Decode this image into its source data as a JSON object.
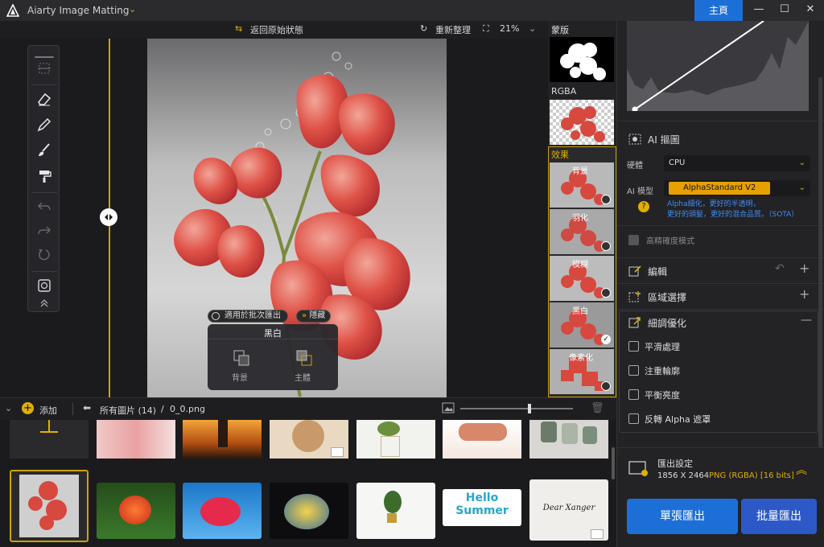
{
  "titlebar": {
    "app_title": "Aiarty Image Matting",
    "home_label": "主頁",
    "minimize": "—",
    "maximize": "☐",
    "close": "✕"
  },
  "canvas_toolbar": {
    "revert_label": "返回原始狀態",
    "reset_label": "重新整理",
    "zoom_value": "21%"
  },
  "floating": {
    "batch_label": "適用於批次匯出",
    "hide_label": "隱藏",
    "panel_title": "黑白",
    "bg_label": "背景",
    "subject_label": "主體"
  },
  "side_strip": {
    "mask_label": "蒙版",
    "rgba_label": "RGBA",
    "effects_label": "效果",
    "effects": [
      "背景",
      "羽化",
      "模糊",
      "黑白",
      "像素化"
    ]
  },
  "right_panel": {
    "ai_section": "AI 摳圖",
    "hardware_label": "硬體",
    "hardware_value": "CPU",
    "model_label": "AI 模型",
    "model_value": "AlphaStandard  V2",
    "model_desc_1": "Alpha細化，更好的半透明，",
    "model_desc_2": "更好的頭髮，更好的混合品質。（SOTA）",
    "hq_label": "高精確度模式",
    "edit_label": "編輯",
    "region_label": "區域選擇",
    "refine_label": "細調優化",
    "refine_options": [
      "平滑處理",
      "注重輪廓",
      "平衡亮度",
      "反轉 Alpha 遮罩"
    ],
    "export_title": "匯出設定",
    "export_size": "1856 X 2464",
    "export_format": "PNG (RGBA) [16 bits]",
    "single_export": "單張匯出",
    "batch_export": "批量匯出"
  },
  "bottom_bar": {
    "add_label": "添加",
    "breadcrumb_all": "所有圖片 (14)",
    "breadcrumb_sep": "/",
    "breadcrumb_file": "0_0.png"
  },
  "gallery": {
    "hello_line1": "Hello",
    "hello_line2": "Summer",
    "signature": "Dear Xanger"
  },
  "colors": {
    "accent": "#1d6fd8",
    "gold": "#d3a000"
  }
}
